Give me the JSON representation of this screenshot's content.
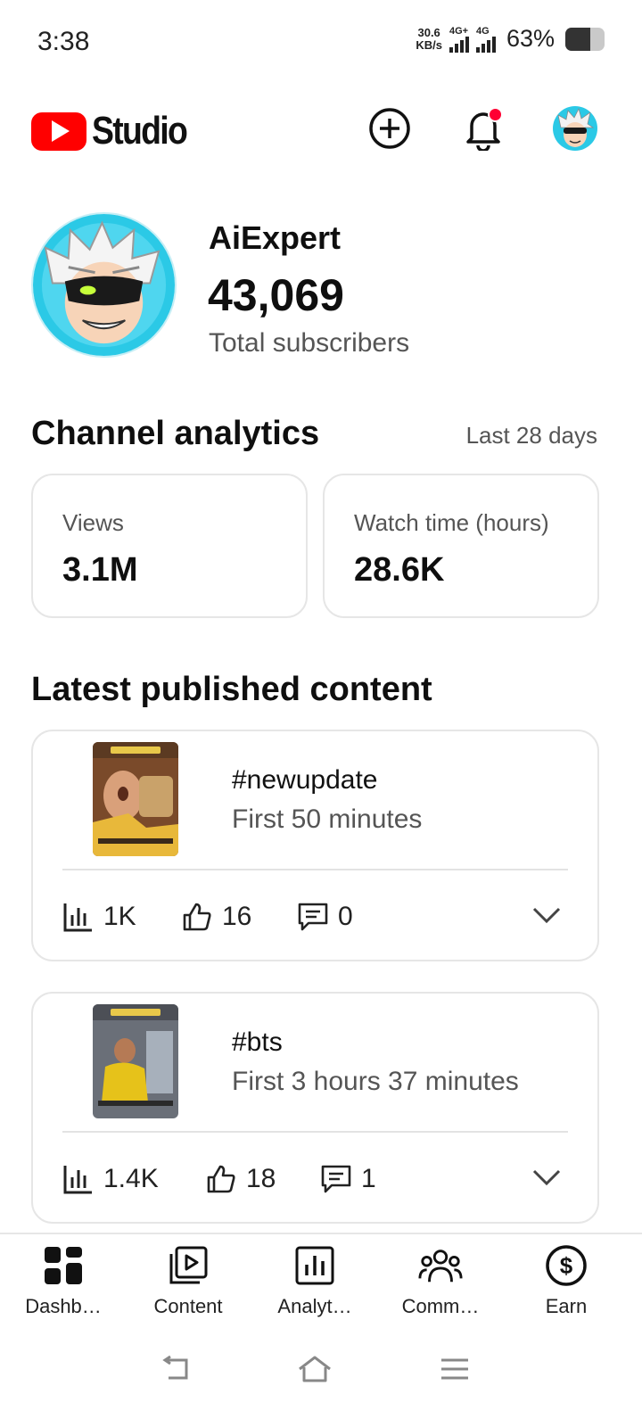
{
  "status_bar": {
    "time": "3:38",
    "net_speed_value": "30.6",
    "net_speed_unit": "KB/s",
    "signal1_label": "4G+",
    "signal2_label": "4G",
    "battery_percent": "63%",
    "battery_level": 0.63
  },
  "header": {
    "logo_text": "Studio",
    "icons": [
      "create-icon",
      "notifications-icon",
      "account-avatar"
    ]
  },
  "channel": {
    "name": "AiExpert",
    "subscriber_count": "43,069",
    "subscriber_label": "Total subscribers"
  },
  "analytics": {
    "title": "Channel analytics",
    "period": "Last 28 days",
    "stats": [
      {
        "label": "Views",
        "value": "3.1M"
      },
      {
        "label": "Watch time (hours)",
        "value": "28.6K"
      }
    ]
  },
  "latest": {
    "title": "Latest published content",
    "items": [
      {
        "title": "#newupdate",
        "subtitle": "First 50 minutes",
        "views": "1K",
        "likes": "16",
        "comments": "0"
      },
      {
        "title": "#bts",
        "subtitle": "First 3 hours 37 minutes",
        "views": "1.4K",
        "likes": "18",
        "comments": "1"
      }
    ]
  },
  "bottom_nav": [
    {
      "label": "Dashb…",
      "icon": "dashboard-icon"
    },
    {
      "label": "Content",
      "icon": "content-icon"
    },
    {
      "label": "Analyt…",
      "icon": "analytics-icon"
    },
    {
      "label": "Comm…",
      "icon": "community-icon"
    },
    {
      "label": "Earn",
      "icon": "earn-icon"
    }
  ],
  "colors": {
    "brand_red": "#ff0000",
    "notification_dot": "#ff0033",
    "avatar_bg": "#2bc9e6"
  }
}
